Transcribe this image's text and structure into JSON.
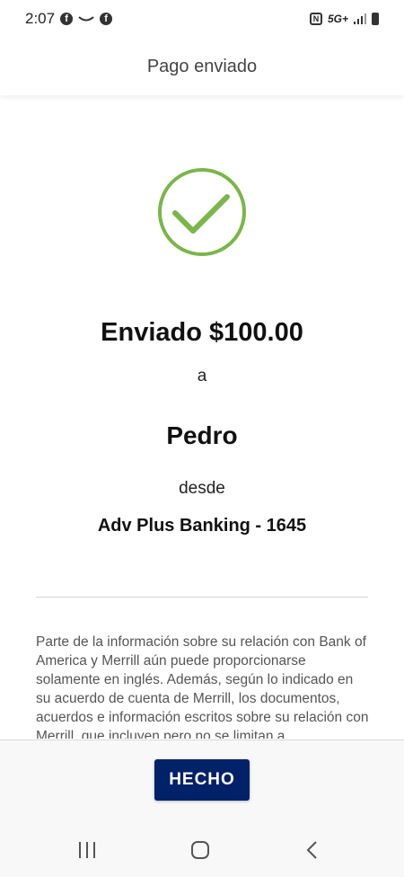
{
  "status_bar": {
    "time": "2:07",
    "network": "5G+",
    "icons": [
      "facebook-icon",
      "smile-icon",
      "facebook-icon",
      "nfc-icon",
      "signal-icon",
      "battery-icon"
    ]
  },
  "header": {
    "title": "Pago enviado"
  },
  "confirmation": {
    "icon": "checkmark-circle-icon",
    "accent_color": "#7ab648",
    "sent_amount": "Enviado $100.00",
    "to_label": "a",
    "recipient": "Pedro",
    "from_label": "desde",
    "account": "Adv Plus Banking - 1645"
  },
  "disclaimer": {
    "text": "Parte de la información sobre su relación con Bank of America y Merrill aún puede proporcionarse solamente en inglés. Además, según lo indicado en su acuerdo de cuenta de Merrill, los documentos, acuerdos e información escritos sobre su relación con Merrill, que incluyen pero no se limitan a"
  },
  "footer": {
    "done_label": "HECHO",
    "button_color": "#012169"
  },
  "nav_bar": {
    "icons": [
      "recents-icon",
      "home-icon",
      "back-icon"
    ]
  }
}
